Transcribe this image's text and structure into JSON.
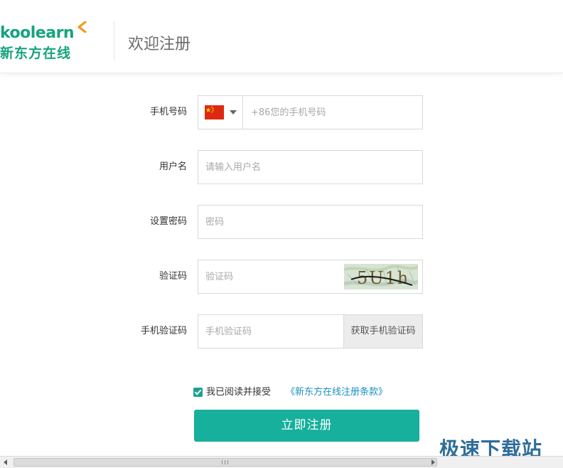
{
  "header": {
    "logo_en": "koolearn",
    "logo_cn": "新东方在线",
    "title": "欢迎注册"
  },
  "form": {
    "phone": {
      "label": "手机号码",
      "country_flag": "china-flag-icon",
      "placeholder": "+86您的手机号码",
      "value": ""
    },
    "username": {
      "label": "用户名",
      "placeholder": "请输入用户名",
      "value": ""
    },
    "password": {
      "label": "设置密码",
      "placeholder": "密码",
      "value": ""
    },
    "captcha": {
      "label": "验证码",
      "placeholder": "验证码",
      "value": "",
      "image_text": "5U1h"
    },
    "sms_code": {
      "label": "手机验证码",
      "placeholder": "手机验证码",
      "value": "",
      "button_label": "获取手机验证码"
    }
  },
  "agreement": {
    "checked": true,
    "text": "我已阅读并接受",
    "link_text": "《新东方在线注册条款》"
  },
  "submit_label": "立即注册",
  "watermark": "极速下载站",
  "colors": {
    "brand_green": "#17a37f",
    "button_teal": "#16b09c",
    "link_blue": "#1a8fc3"
  }
}
